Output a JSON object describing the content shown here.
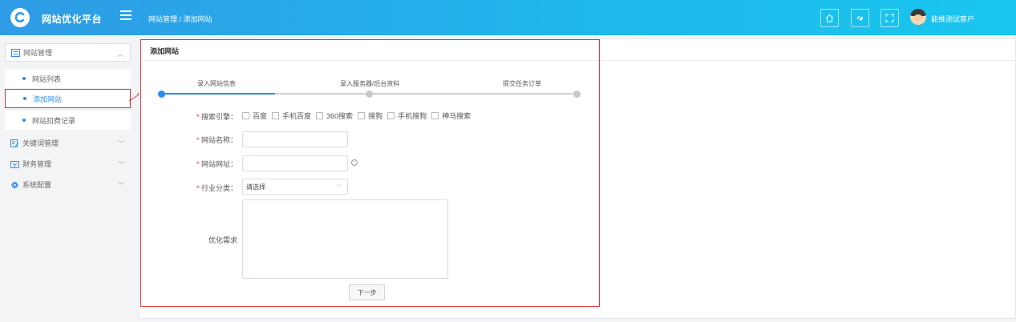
{
  "header": {
    "app_title": "网站优化平台",
    "breadcrumb": "网站管理 / 添加网站",
    "user_name": "能推测试客户"
  },
  "sidebar": {
    "groups": [
      {
        "label": "网站管理",
        "icon": "list-icon",
        "expanded": true
      },
      {
        "label": "关键词管理",
        "icon": "edit-doc-icon"
      },
      {
        "label": "财务管理",
        "icon": "wallet-icon"
      },
      {
        "label": "系统配置",
        "icon": "gear-icon"
      }
    ],
    "sub_items": [
      {
        "label": "网站列表"
      },
      {
        "label": "添加网站",
        "active": true
      },
      {
        "label": "网站扣费记录"
      }
    ]
  },
  "panel": {
    "title": "添加网站"
  },
  "steps": [
    {
      "label": "录入网站信息",
      "done": true
    },
    {
      "label": "录入服务器/后台资料",
      "done": false
    },
    {
      "label": "提交任务订单",
      "done": false
    }
  ],
  "form": {
    "engines_label": "搜索引擎：",
    "engines": [
      "百度",
      "手机百度",
      "360搜索",
      "搜狗",
      "手机搜狗",
      "神马搜索"
    ],
    "name_label": "网站名称：",
    "url_label": "网站网址：",
    "category_label": "行业分类：",
    "category_value": "请选择",
    "requirement_label": "优化需求",
    "required_mark": "*",
    "info_mark": "i",
    "next_button": "下一步"
  },
  "colors": {
    "header_start": "#2f9be6",
    "header_end": "#19c6ee",
    "accent": "#2d8cf0",
    "highlight_border": "#e0343a"
  }
}
